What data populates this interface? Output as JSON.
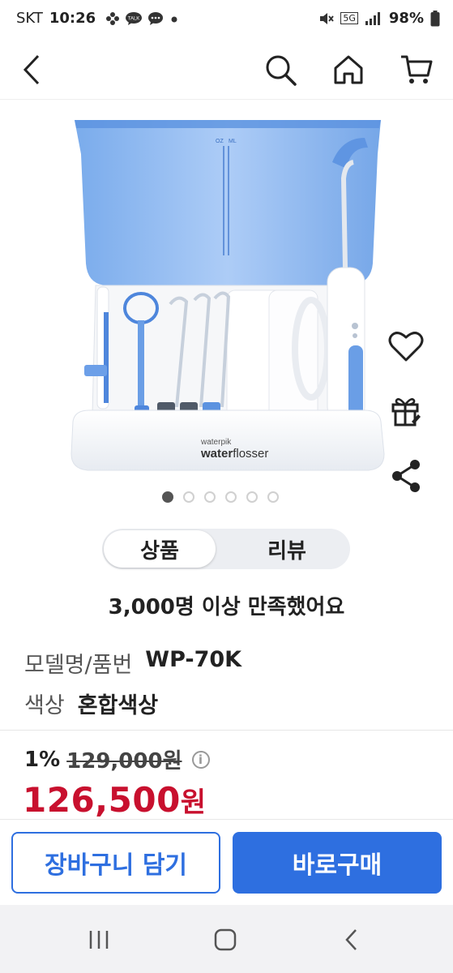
{
  "status_bar": {
    "carrier": "SKT",
    "time": "10:26",
    "network": "5G",
    "battery": "98%",
    "icons": [
      "pinwheel-icon",
      "talk-icon",
      "chat-icon",
      "dot-icon",
      "mute-icon",
      "signal-icon"
    ]
  },
  "header": {
    "icons": [
      "back-icon",
      "search-icon",
      "home-icon",
      "cart-icon"
    ]
  },
  "product_image": {
    "brand_small": "waterpik",
    "brand_large_a": "water",
    "brand_large_b": "flosser",
    "scale_oz": "OZ",
    "scale_ml": "ML"
  },
  "side_actions": [
    "heart-icon",
    "gift-icon",
    "share-icon"
  ],
  "carousel": {
    "total": 6,
    "active_index": 0
  },
  "tabs": {
    "product": "상품",
    "review": "리뷰",
    "active": "product"
  },
  "satisfaction": "3,000명 이상 만족했어요",
  "specs": [
    {
      "key": "모델명/품번",
      "value": "WP-70K"
    },
    {
      "key": "색상",
      "value": "혼합색상"
    }
  ],
  "price": {
    "discount": "1%",
    "original": "129,000원",
    "info_symbol": "i",
    "sale_amount": "126,500",
    "sale_unit": "원"
  },
  "buttons": {
    "cart": "장바구니 담기",
    "buy": "바로구매"
  },
  "colors": {
    "primary": "#2e6fe0",
    "sale": "#c8102e",
    "tank": "#7fb0ef"
  },
  "nav_bar": [
    "recents-icon",
    "home-nav-icon",
    "back-nav-icon"
  ]
}
